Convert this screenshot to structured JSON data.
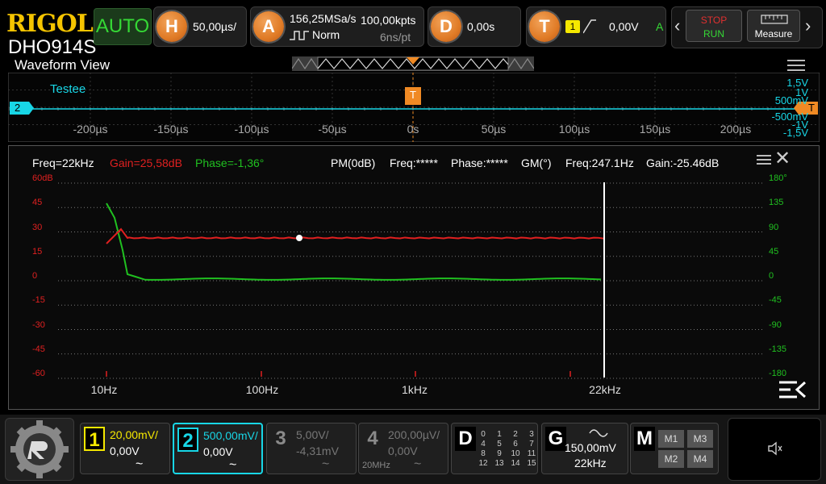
{
  "brand": {
    "logo": "RIGOL",
    "model": "DHO914S"
  },
  "trigger_mode": "AUTO",
  "horizontal": {
    "label": "H",
    "timebase": "50,00µs/"
  },
  "acquire": {
    "label": "A",
    "sample_rate": "156,25MSa/s",
    "points": "100,00kpts",
    "mode": "Norm",
    "resolution": "6ns/pt"
  },
  "delay": {
    "label": "D",
    "value": "0,00s"
  },
  "trigger": {
    "label": "T",
    "source": "1",
    "level": "0,00V",
    "mode": "A"
  },
  "run_control": {
    "stop": "STOP",
    "run": "RUN"
  },
  "measure_label": "Measure",
  "waveform_view": {
    "title": "Waveform View",
    "channel_label": "Testee",
    "channel_marker": "2",
    "trigger_marker": "T",
    "time_ticks": [
      "-200µs",
      "-150µs",
      "-100µs",
      "-50µs",
      "0s",
      "50µs",
      "100µs",
      "150µs",
      "200µs"
    ],
    "volt_labels": [
      "1,5V",
      "1V",
      "500mV",
      "-500mV",
      "-1V",
      "-1,5V"
    ]
  },
  "bode": {
    "freq_readout": "Freq=22kHz",
    "gain_readout": "Gain=25,58dB",
    "phase_readout": "Phase=-1,36°",
    "pm": "PM(0dB)",
    "pm_freq": "Freq:*****",
    "pm_phase": "Phase:*****",
    "gm": "GM(°)",
    "gm_freq": "Freq:247.1Hz",
    "gm_gain": "Gain:-25.46dB",
    "gain_axis": [
      "60dB",
      "45",
      "30",
      "15",
      "0",
      "-15",
      "-30",
      "-45",
      "-60"
    ],
    "phase_axis": [
      "180°",
      "135",
      "90",
      "45",
      "0",
      "-45",
      "-90",
      "-135",
      "-180"
    ],
    "freq_axis": [
      "10Hz",
      "100Hz",
      "1kHz",
      "22kHz"
    ],
    "colors": {
      "gain": "#e02020",
      "phase": "#20c020"
    }
  },
  "channels": [
    {
      "num": "1",
      "scale": "20,00mV/",
      "offset": "0,00V",
      "coupling": "~",
      "color": "#f5e800",
      "active": true
    },
    {
      "num": "2",
      "scale": "500,00mV/",
      "offset": "0,00V",
      "coupling": "~",
      "color": "#18d6e6",
      "active": true
    },
    {
      "num": "3",
      "scale": "5,00V/",
      "offset": "-4,31mV",
      "coupling": "~",
      "color": "#8a8a8a",
      "active": false
    },
    {
      "num": "4",
      "scale": "200,00µV/",
      "offset": "0,00V",
      "coupling": "~",
      "bw": "20MHz",
      "color": "#8a8a8a",
      "active": false
    }
  ],
  "digital": {
    "label": "D",
    "grid": [
      [
        "0",
        "1",
        "2",
        "3"
      ],
      [
        "4",
        "5",
        "6",
        "7"
      ],
      [
        "8",
        "9",
        "10",
        "11"
      ],
      [
        "12",
        "13",
        "14",
        "15"
      ]
    ]
  },
  "generator": {
    "label": "G",
    "amplitude": "150,00mV",
    "frequency": "22kHz"
  },
  "math": {
    "label": "M",
    "items": [
      "M1",
      "M3",
      "M2",
      "M4"
    ]
  }
}
